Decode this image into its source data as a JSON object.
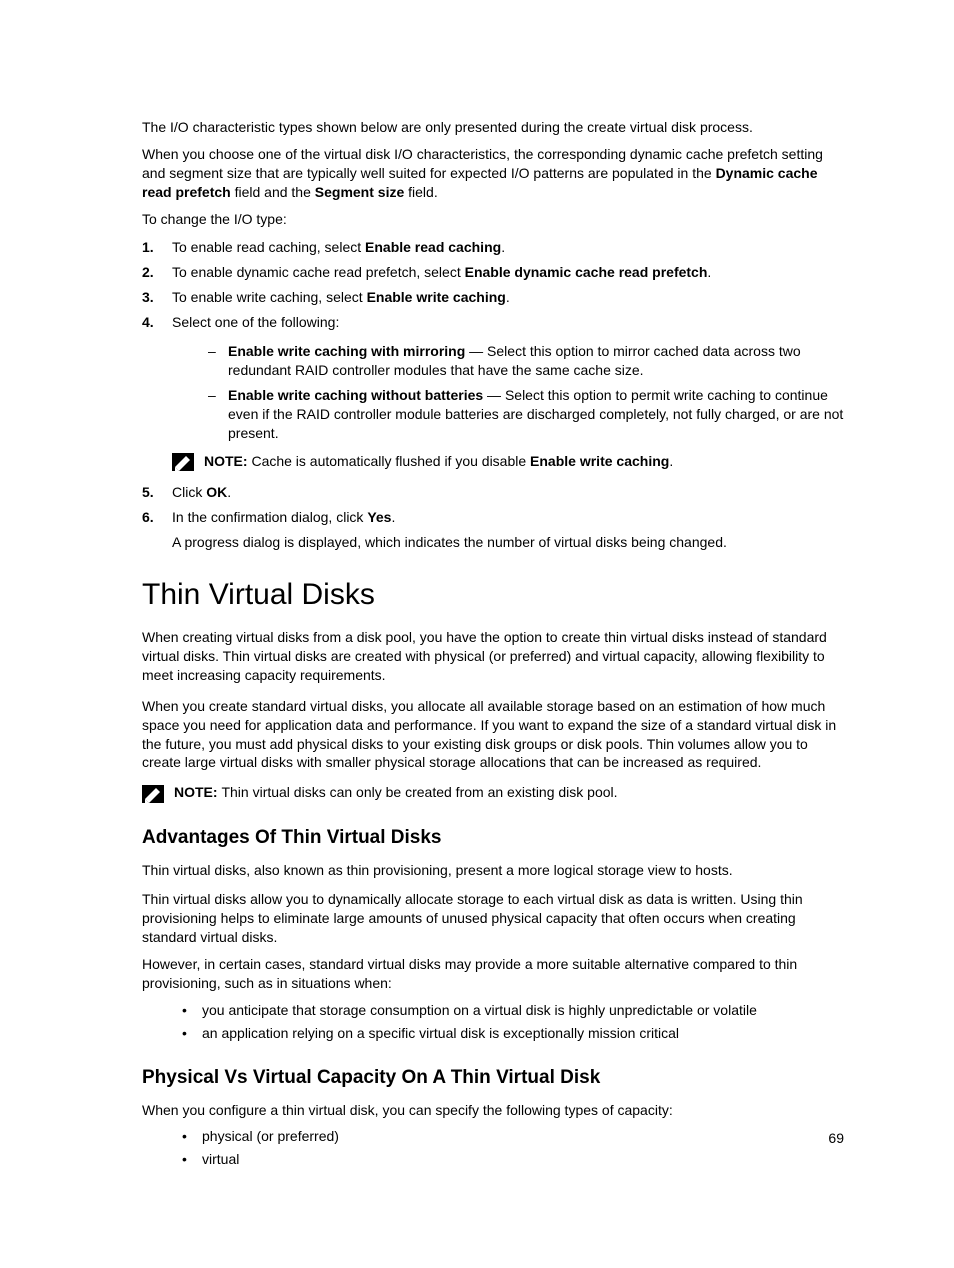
{
  "para1": "The I/O characteristic types shown below are only presented during the create virtual disk process.",
  "para2_pre": "When you choose one of the virtual disk I/O characteristics, the corresponding dynamic cache prefetch setting and segment size that are typically well suited for expected I/O patterns are populated in the ",
  "para2_b1": "Dynamic cache read prefetch",
  "para2_mid": " field and the ",
  "para2_b2": "Segment size",
  "para2_post": " field.",
  "para3": "To change the I/O type:",
  "steps": {
    "n1": "1.",
    "s1_pre": "To enable read caching, select ",
    "s1_b": "Enable read caching",
    "s1_post": ".",
    "n2": "2.",
    "s2_pre": "To enable dynamic cache read prefetch, select ",
    "s2_b": "Enable dynamic cache read prefetch",
    "s2_post": ".",
    "n3": "3.",
    "s3_pre": "To enable write caching, select ",
    "s3_b": "Enable write caching",
    "s3_post": ".",
    "n4": "4.",
    "s4": "Select one of the following:",
    "sub1_b": "Enable write caching with mirroring",
    "sub1_rest": " — Select this option to mirror cached data across two redundant RAID controller modules that have the same cache size.",
    "sub2_b": "Enable write caching without batteries",
    "sub2_rest": " — Select this option to permit write caching to continue even if the RAID controller module batteries are discharged completely, not fully charged, or are not present.",
    "note1_label": "NOTE: ",
    "note1_pre": " Cache is automatically flushed if you disable ",
    "note1_b": "Enable write caching",
    "note1_post": ".",
    "n5": "5.",
    "s5_pre": "Click ",
    "s5_b": "OK",
    "s5_post": ".",
    "n6": "6.",
    "s6_pre": "In the confirmation dialog, click ",
    "s6_b": "Yes",
    "s6_post": ".",
    "s6_line2": "A progress dialog is displayed, which indicates the number of virtual disks being changed."
  },
  "h1": "Thin Virtual Disks",
  "thin_p1": "When creating virtual disks from a disk pool, you have the option to create thin virtual disks instead of standard virtual disks. Thin virtual disks are created with physical (or preferred) and virtual capacity, allowing flexibility to meet increasing capacity requirements.",
  "thin_p2": "When you create standard virtual disks, you allocate all available storage based on an estimation of how much space you need for application data and performance. If you want to expand the size of a standard virtual disk in the future, you must add physical disks to your existing disk groups or disk pools. Thin volumes allow you to create large virtual disks with smaller physical storage allocations that can be increased as required.",
  "note2_label": "NOTE: ",
  "note2_text": "Thin virtual disks can only be created from an existing disk pool.",
  "h2_adv": "Advantages Of Thin Virtual Disks",
  "adv_p1": "Thin virtual disks, also known as thin provisioning, present a more logical storage view to hosts.",
  "adv_p2": "Thin virtual disks allow you to dynamically allocate storage to each virtual disk as data is written. Using thin provisioning helps to eliminate large amounts of unused physical capacity that often occurs when creating standard virtual disks.",
  "adv_p3": "However, in certain cases, standard virtual disks may provide a more suitable alternative compared to thin provisioning, such as in situations when:",
  "adv_b1": "you anticipate that storage consumption on a virtual disk is highly unpredictable or volatile",
  "adv_b2": "an application relying on a specific virtual disk is exceptionally mission critical",
  "h2_phys": "Physical Vs Virtual Capacity On A Thin Virtual Disk",
  "phys_p1": "When you configure a thin virtual disk, you can specify the following types of capacity:",
  "phys_b1": "physical (or preferred)",
  "phys_b2": "virtual",
  "pagenum": "69",
  "dash": "–",
  "bullet": "•"
}
